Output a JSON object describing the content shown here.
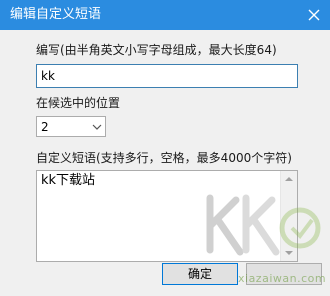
{
  "window": {
    "title": "编辑自定义短语"
  },
  "code_field": {
    "label": "编写(由半角英文小写字母组成，最大长度64)",
    "value": "kk"
  },
  "position_field": {
    "label": "在候选中的位置",
    "selected": "2"
  },
  "phrase_field": {
    "label": "自定义短语(支持多行，空格，最多4000个字符)",
    "value": "kk下载站"
  },
  "buttons": {
    "ok_label": "确定",
    "cancel_label": ""
  },
  "watermark": {
    "site": "xiazaiwan.com",
    "logo_icon": "k-logo-icon"
  },
  "colors": {
    "title_bar": "#2b8ce0",
    "client_bg": "#f0f0f0",
    "focus_border": "#3c7fb1"
  }
}
